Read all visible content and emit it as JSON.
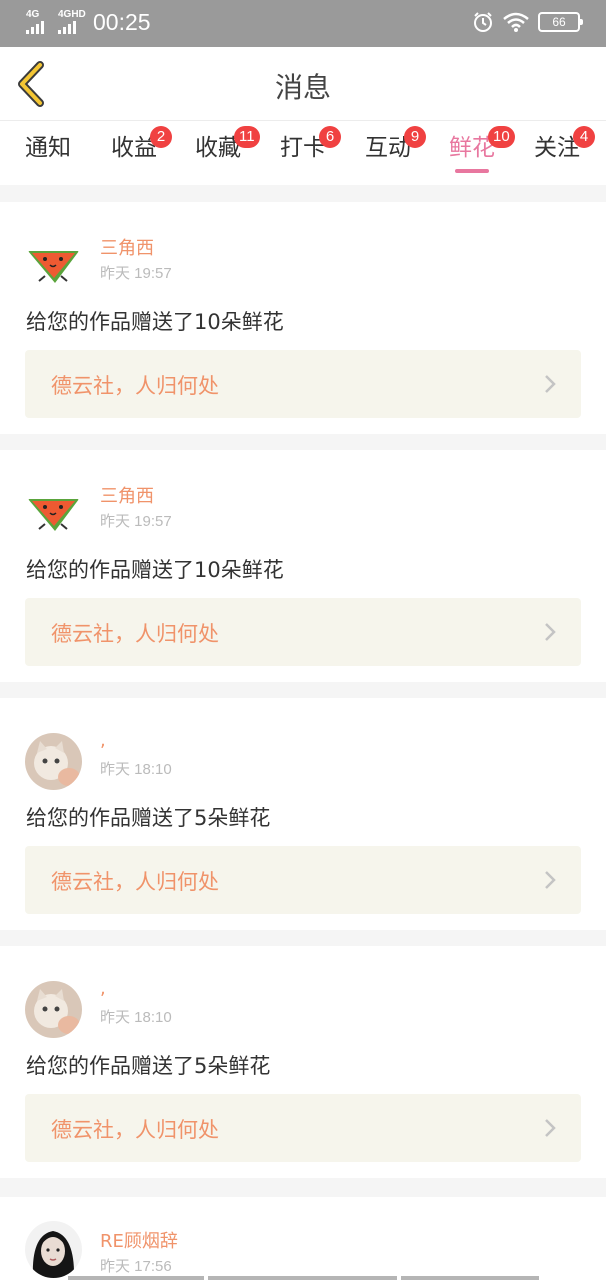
{
  "status_bar": {
    "net1": "4G",
    "net2": "4GHD",
    "time": "00:25",
    "battery": "66"
  },
  "header": {
    "title": "消息"
  },
  "tabs": [
    {
      "label": "通知",
      "badge": ""
    },
    {
      "label": "收益",
      "badge": "2"
    },
    {
      "label": "收藏",
      "badge": "11"
    },
    {
      "label": "打卡",
      "badge": "6"
    },
    {
      "label": "互动",
      "badge": "9"
    },
    {
      "label": "鲜花",
      "badge": "10",
      "active": true
    },
    {
      "label": "关注",
      "badge": "4"
    }
  ],
  "messages": [
    {
      "avatar": "watermelon",
      "user": "三角西",
      "time": "昨天 19:57",
      "text": "给您的作品赠送了10朵鲜花",
      "work": "德云社，人归何处"
    },
    {
      "avatar": "watermelon",
      "user": "三角西",
      "time": "昨天 19:57",
      "text": "给您的作品赠送了10朵鲜花",
      "work": "德云社，人归何处"
    },
    {
      "avatar": "cat-photo",
      "user": ",",
      "time": "昨天 18:10",
      "text": "给您的作品赠送了5朵鲜花",
      "work": "德云社，人归何处"
    },
    {
      "avatar": "cat-photo",
      "user": ",",
      "time": "昨天 18:10",
      "text": "给您的作品赠送了5朵鲜花",
      "work": "德云社，人归何处"
    }
  ],
  "partial_message": {
    "avatar": "girl-photo",
    "user": "RE顾烟辞",
    "time": "昨天 17:56"
  },
  "colors": {
    "accent": "#e8779f",
    "username": "#f0936a",
    "badge": "#f04141",
    "work_bg": "#f6f5ec"
  }
}
